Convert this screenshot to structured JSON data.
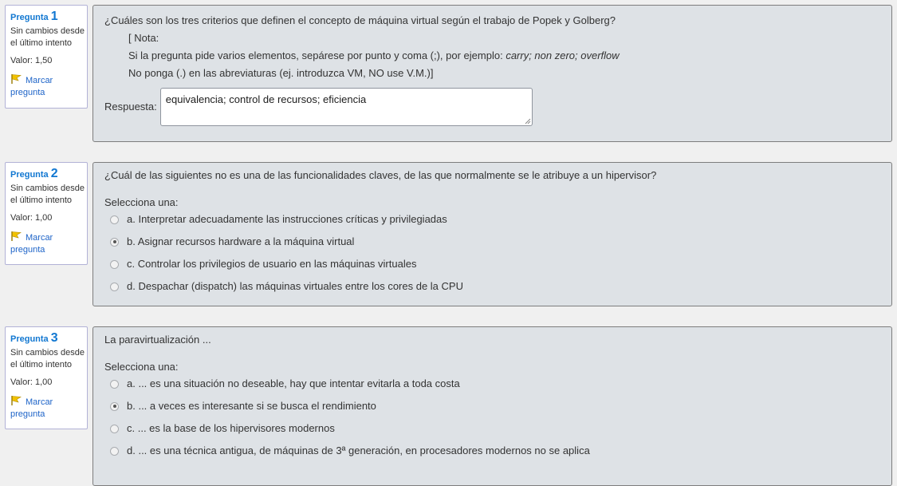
{
  "questions": [
    {
      "label": "Pregunta",
      "number": "1",
      "state": "Sin cambios desde el último intento",
      "grade": "Valor: 1,50",
      "flag": "Marcar pregunta",
      "text": "¿Cuáles son los tres criterios que definen el concepto de máquina virtual según el trabajo de Popek y Golberg?",
      "note_open": "[ Nota:",
      "note_line1_prefix": "Si la pregunta pide varios elementos, sepárese por punto y coma (;), por ejemplo: ",
      "note_line1_example": "carry; non zero; overflow",
      "note_line2": "No ponga (.) en las abreviaturas (ej. introduzca VM,  NO use V.M.)]",
      "answer_label": "Respuesta:",
      "answer_value": "equivalencia; control de recursos; eficiencia"
    },
    {
      "label": "Pregunta",
      "number": "2",
      "state": "Sin cambios desde el último intento",
      "grade": "Valor: 1,00",
      "flag": "Marcar pregunta",
      "text": "¿Cuál de las siguientes no es una de las funcionalidades claves, de las que normalmente se le atribuye a un hipervisor?",
      "prompt": "Selecciona una:",
      "options": [
        "a. Interpretar adecuadamente las instrucciones críticas y privilegiadas",
        "b. Asignar recursos hardware a la máquina virtual",
        "c. Controlar los privilegios de usuario en las máquinas virtuales",
        "d. Despachar (dispatch) las máquinas virtuales entre los cores de la CPU"
      ],
      "selected": "b"
    },
    {
      "label": "Pregunta",
      "number": "3",
      "state": "Sin cambios desde el último intento",
      "grade": "Valor: 1,00",
      "flag": "Marcar pregunta",
      "text": "La paravirtualización ...",
      "prompt": "Selecciona una:",
      "options": [
        "a. ... es una situación no deseable, hay que intentar evitarla a toda costa",
        "b. ... a veces es interesante si se busca el rendimiento",
        "c. ... es la base de los hipervisores modernos",
        "d. ... es una técnica antigua, de máquinas de 3ª generación, en procesadores modernos no se aplica"
      ],
      "selected": "b"
    }
  ],
  "colors": {
    "accent": "#1177d1",
    "flag": "#e6b800",
    "panel_bg": "#dee2e6",
    "info_border": "#b2b2d6"
  },
  "icons": {
    "flag": "flag-icon",
    "resize": "resize-grip-icon"
  }
}
